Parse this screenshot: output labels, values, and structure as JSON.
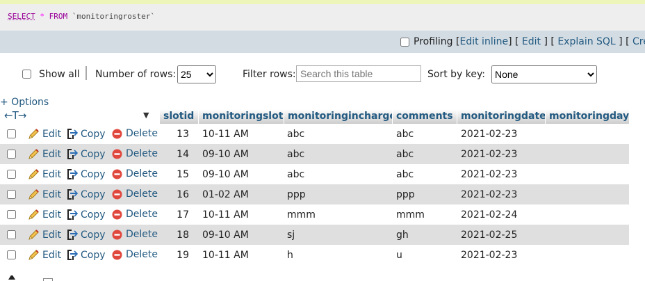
{
  "sql": {
    "select": "SELECT",
    "star": "*",
    "from": "FROM",
    "table": "`monitoringroster`"
  },
  "profiling": {
    "label": "Profiling",
    "edit_inline": "Edit inline",
    "edit": "Edit",
    "explain_sql": "Explain SQL",
    "create": "Create"
  },
  "nav": {
    "show_all": "Show all",
    "number_of_rows_label": "Number of rows:",
    "number_of_rows_value": "25",
    "filter_rows_label": "Filter rows:",
    "filter_placeholder": "Search this table",
    "sort_by_key_label": "Sort by key:",
    "sort_by_key_value": "None"
  },
  "options_label": "+ Options",
  "header_arrows": "←T→",
  "columns": [
    "slotid",
    "monitoringslot",
    "monitoringincharge",
    "comments",
    "monitoringdate",
    "monitoringday"
  ],
  "actions": {
    "edit": "Edit",
    "copy": "Copy",
    "delete": "Delete"
  },
  "rows": [
    {
      "slotid": "13",
      "monitoringslot": "10-11 AM",
      "monitoringincharge": "abc",
      "comments": "abc",
      "monitoringdate": "2021-02-23",
      "monitoringday": ""
    },
    {
      "slotid": "14",
      "monitoringslot": "09-10 AM",
      "monitoringincharge": "abc",
      "comments": "abc",
      "monitoringdate": "2021-02-23",
      "monitoringday": ""
    },
    {
      "slotid": "15",
      "monitoringslot": "09-10 AM",
      "monitoringincharge": "abc",
      "comments": "abc",
      "monitoringdate": "2021-02-23",
      "monitoringday": ""
    },
    {
      "slotid": "16",
      "monitoringslot": "01-02 AM",
      "monitoringincharge": "ppp",
      "comments": "ppp",
      "monitoringdate": "2021-02-23",
      "monitoringday": ""
    },
    {
      "slotid": "17",
      "monitoringslot": "10-11 AM",
      "monitoringincharge": "mmm",
      "comments": "mmm",
      "monitoringdate": "2021-02-24",
      "monitoringday": ""
    },
    {
      "slotid": "18",
      "monitoringslot": "09-10 AM",
      "monitoringincharge": "sj",
      "comments": "gh",
      "monitoringdate": "2021-02-25",
      "monitoringday": ""
    },
    {
      "slotid": "19",
      "monitoringslot": "10-11 AM",
      "monitoringincharge": "h",
      "comments": "u",
      "monitoringdate": "2021-02-23",
      "monitoringday": ""
    }
  ],
  "colors": {
    "link": "#235a81",
    "row_alt": "#dfdfdf",
    "profiling_bg": "#d3dce3",
    "top_accent": "#eef5b9",
    "delete_icon": "#e0483e"
  },
  "icons": [
    "pencil-icon",
    "copy-icon",
    "delete-icon",
    "sort-dropdown-icon"
  ]
}
